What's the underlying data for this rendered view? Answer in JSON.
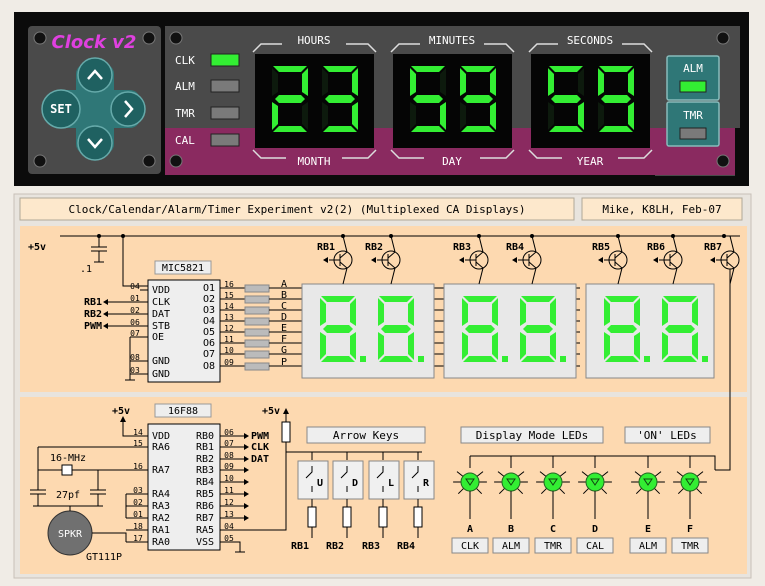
{
  "device": {
    "logo": "Clock v2",
    "set_label": "SET",
    "mode_labels": [
      "CLK",
      "ALM",
      "TMR",
      "CAL"
    ],
    "top_labels": [
      "HOURS",
      "MINUTES",
      "SECONDS"
    ],
    "bottom_labels": [
      "MONTH",
      "DAY",
      "YEAR"
    ],
    "digits": [
      "23",
      "59",
      "59"
    ],
    "side_buttons": [
      "ALM",
      "TMR"
    ],
    "colors": {
      "led_green": "#33ee33",
      "panel_teal": "#2f7777",
      "cal_band": "#8a2a60",
      "logo": "#e040e0"
    }
  },
  "schematic": {
    "title": "Clock/Calendar/Alarm/Timer Experiment v2(2) (Multiplexed CA Displays)",
    "author": "Mike, K8LH, Feb-07",
    "supply": "+5v",
    "cap_value": ".1",
    "driver_chip": "MIC5821",
    "driver_left_pins": [
      {
        "num": "04",
        "name": "VDD",
        "net": ""
      },
      {
        "num": "01",
        "name": "CLK",
        "net": "RB1"
      },
      {
        "num": "02",
        "name": "DAT",
        "net": "RB2"
      },
      {
        "num": "06",
        "name": "STB",
        "net": "PWM"
      },
      {
        "num": "07",
        "name": "OE",
        "net": ""
      },
      {
        "num": "08",
        "name": "GND",
        "net": ""
      },
      {
        "num": "03",
        "name": "GND",
        "net": ""
      }
    ],
    "driver_right_pins": [
      {
        "num": "16",
        "name": "O1",
        "seg": "A"
      },
      {
        "num": "15",
        "name": "O2",
        "seg": "B"
      },
      {
        "num": "14",
        "name": "O3",
        "seg": "C"
      },
      {
        "num": "13",
        "name": "O4",
        "seg": "D"
      },
      {
        "num": "12",
        "name": "O5",
        "seg": "E"
      },
      {
        "num": "11",
        "name": "O6",
        "seg": "F"
      },
      {
        "num": "10",
        "name": "O7",
        "seg": "G"
      },
      {
        "num": "09",
        "name": "O8",
        "seg": "P"
      }
    ],
    "digit_drivers": [
      "RB1",
      "RB2",
      "RB3",
      "RB4",
      "RB5",
      "RB6",
      "RB7"
    ],
    "mcu_chip": "16F88",
    "mcu_left_pins": [
      {
        "num": "14",
        "name": "VDD"
      },
      {
        "num": "15",
        "name": "RA6"
      },
      {
        "num": "16",
        "name": "RA7"
      },
      {
        "num": "03",
        "name": "RA4"
      },
      {
        "num": "02",
        "name": "RA3"
      },
      {
        "num": "01",
        "name": "RA2"
      },
      {
        "num": "18",
        "name": "RA1"
      },
      {
        "num": "17",
        "name": "RA0"
      }
    ],
    "mcu_right_pins": [
      {
        "num": "06",
        "name": "RB0",
        "net": "PWM"
      },
      {
        "num": "07",
        "name": "RB1",
        "net": "CLK"
      },
      {
        "num": "08",
        "name": "RB2",
        "net": "DAT"
      },
      {
        "num": "09",
        "name": "RB3",
        "net": ""
      },
      {
        "num": "10",
        "name": "RB4",
        "net": ""
      },
      {
        "num": "11",
        "name": "RB5",
        "net": ""
      },
      {
        "num": "12",
        "name": "RB6",
        "net": ""
      },
      {
        "num": "13",
        "name": "RB7",
        "net": ""
      },
      {
        "num": "04",
        "name": "RA5",
        "net": ""
      },
      {
        "num": "05",
        "name": "VSS",
        "net": ""
      }
    ],
    "crystal": "16-MHz",
    "crystal_caps": "27pf",
    "speaker": "SPKR",
    "speaker_part": "GT111P",
    "arrow_keys_title": "Arrow Keys",
    "keys": [
      "U",
      "D",
      "L",
      "R"
    ],
    "key_nets": [
      "RB1",
      "RB2",
      "RB3",
      "RB4"
    ],
    "mode_leds_title": "Display Mode LEDs",
    "on_leds_title": "'ON' LEDs",
    "led_letters": [
      "A",
      "B",
      "C",
      "D",
      "E",
      "F"
    ],
    "led_labels": [
      "CLK",
      "ALM",
      "TMR",
      "CAL",
      "ALM",
      "TMR"
    ]
  }
}
